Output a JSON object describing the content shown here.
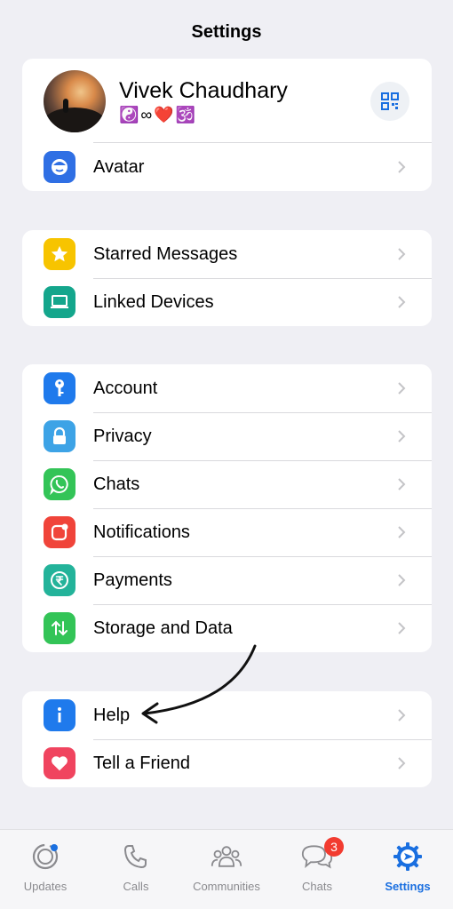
{
  "header": {
    "title": "Settings"
  },
  "profile": {
    "name": "Vivek Chaudhary",
    "status": "☯️∞❤️🕉️",
    "qr_icon": "qr-code-icon"
  },
  "group1": [
    {
      "label": "Avatar",
      "icon": "avatar-icon",
      "color": "#2f6fe4"
    }
  ],
  "group2": [
    {
      "label": "Starred Messages",
      "icon": "star-icon",
      "color": "#f7c400"
    },
    {
      "label": "Linked Devices",
      "icon": "laptop-icon",
      "color": "#14a68c"
    }
  ],
  "group3": [
    {
      "label": "Account",
      "icon": "key-icon",
      "color": "#1f7aec"
    },
    {
      "label": "Privacy",
      "icon": "lock-icon",
      "color": "#3da3e6"
    },
    {
      "label": "Chats",
      "icon": "whatsapp-icon",
      "color": "#33c457"
    },
    {
      "label": "Notifications",
      "icon": "notification-icon",
      "color": "#f0443a"
    },
    {
      "label": "Payments",
      "icon": "rupee-icon",
      "color": "#23b39a"
    },
    {
      "label": "Storage and Data",
      "icon": "arrows-updown-icon",
      "color": "#33c457"
    }
  ],
  "group4": [
    {
      "label": "Help",
      "icon": "info-icon",
      "color": "#1f7aec"
    },
    {
      "label": "Tell a Friend",
      "icon": "heart-icon",
      "color": "#f0445f"
    }
  ],
  "tabs": [
    {
      "label": "Updates",
      "icon": "updates-icon"
    },
    {
      "label": "Calls",
      "icon": "phone-icon"
    },
    {
      "label": "Communities",
      "icon": "communities-icon"
    },
    {
      "label": "Chats",
      "icon": "chat-bubbles-icon",
      "badge": "3"
    },
    {
      "label": "Settings",
      "icon": "settings-gear-icon",
      "active": true
    }
  ],
  "colors": {
    "accent": "#1a6fe0",
    "badge": "#f23b30",
    "background": "#efeff4"
  }
}
